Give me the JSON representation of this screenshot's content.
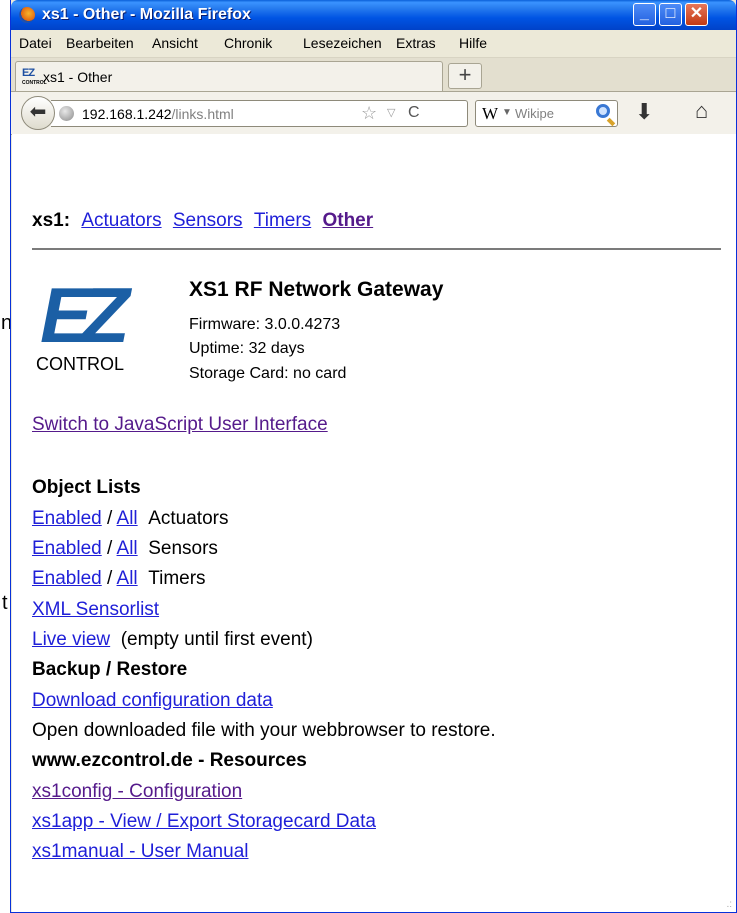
{
  "background": {
    "glyph_1": "n",
    "glyph_2": "t"
  },
  "window": {
    "title": "xs1 - Other - Mozilla Firefox",
    "buttons": {
      "minimize": "_",
      "maximize": "□",
      "close": "✕"
    }
  },
  "menubar": [
    "Datei",
    "Bearbeiten",
    "Ansicht",
    "Chronik",
    "Lesezeichen",
    "Extras",
    "Hilfe"
  ],
  "tab": {
    "favicon_mark": "EZ",
    "favicon_sub": "CONTROL",
    "label": "xs1 - Other",
    "new_tab": "+"
  },
  "navbar": {
    "url_host": "192.168.1.242",
    "url_path": "/links.html",
    "search_engine": "W",
    "search_placeholder": "Wikipe"
  },
  "page": {
    "nav": {
      "prefix": "xs1:",
      "links": [
        "Actuators",
        "Sensors",
        "Timers",
        "Other"
      ]
    },
    "logo": {
      "mark": "EZ",
      "text": "CONTROL"
    },
    "gateway": {
      "title": "XS1 RF Network Gateway",
      "firmware": "Firmware: 3.0.0.4273",
      "uptime": "Uptime: 32 days",
      "storage": "Storage Card: no card"
    },
    "js_ui_link": "Switch to JavaScript User Interface",
    "object_lists": {
      "heading": "Object Lists",
      "enabled": "Enabled",
      "sep": " / ",
      "all": "All",
      "actuators": "Actuators",
      "sensors": "Sensors",
      "timers": "Timers",
      "xml": "XML Sensorlist",
      "live": "Live view",
      "live_note": "(empty until first event)"
    },
    "backup": {
      "heading": "Backup / Restore",
      "download": "Download configuration data",
      "note": "Open downloaded file with your webbrowser to restore."
    },
    "resources": {
      "heading": "www.ezcontrol.de - Resources",
      "links": [
        "xs1config - Configuration",
        "xs1app - View / Export Storagecard Data",
        "xs1manual - User Manual"
      ]
    }
  },
  "colors": {
    "link": "#1f1fd8",
    "visited": "#551a8b",
    "titlebar": "#0054e3",
    "logo_blue": "#1b5fa5"
  }
}
